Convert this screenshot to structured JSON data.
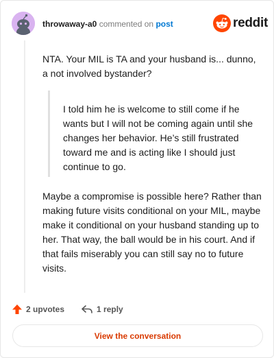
{
  "header": {
    "username": "throwaway-a0",
    "verb": "commented on",
    "post_link": "post",
    "brand": "reddit"
  },
  "comment": {
    "paragraph1": "NTA. Your MIL is TA and your husband is... dunno, a not involved bystander?",
    "quote": "I told him he is welcome to still come if he wants but I will not be coming again until she changes her behavior. He’s still frustrated toward me and is acting like I should just continue to go.",
    "paragraph2": "Maybe a compromise is possible here? Rather than making future visits conditional on your MIL, maybe make it conditional on your husband standing up to her. That way, the ball would be in his court. And if that fails miserably you can still say no to future visits."
  },
  "footer": {
    "upvotes": "2 upvotes",
    "replies": "1 reply",
    "view_conversation": "View the conversation"
  },
  "colors": {
    "upvote": "#ff4500",
    "link": "#0079d3",
    "cta": "#d93a00",
    "avatar_bg": "#d9b3f0"
  },
  "icons": {
    "avatar": "snoo-avatar-icon",
    "brand": "reddit-logo-icon",
    "upvote": "upvote-arrow-icon",
    "reply": "reply-arrow-icon"
  }
}
